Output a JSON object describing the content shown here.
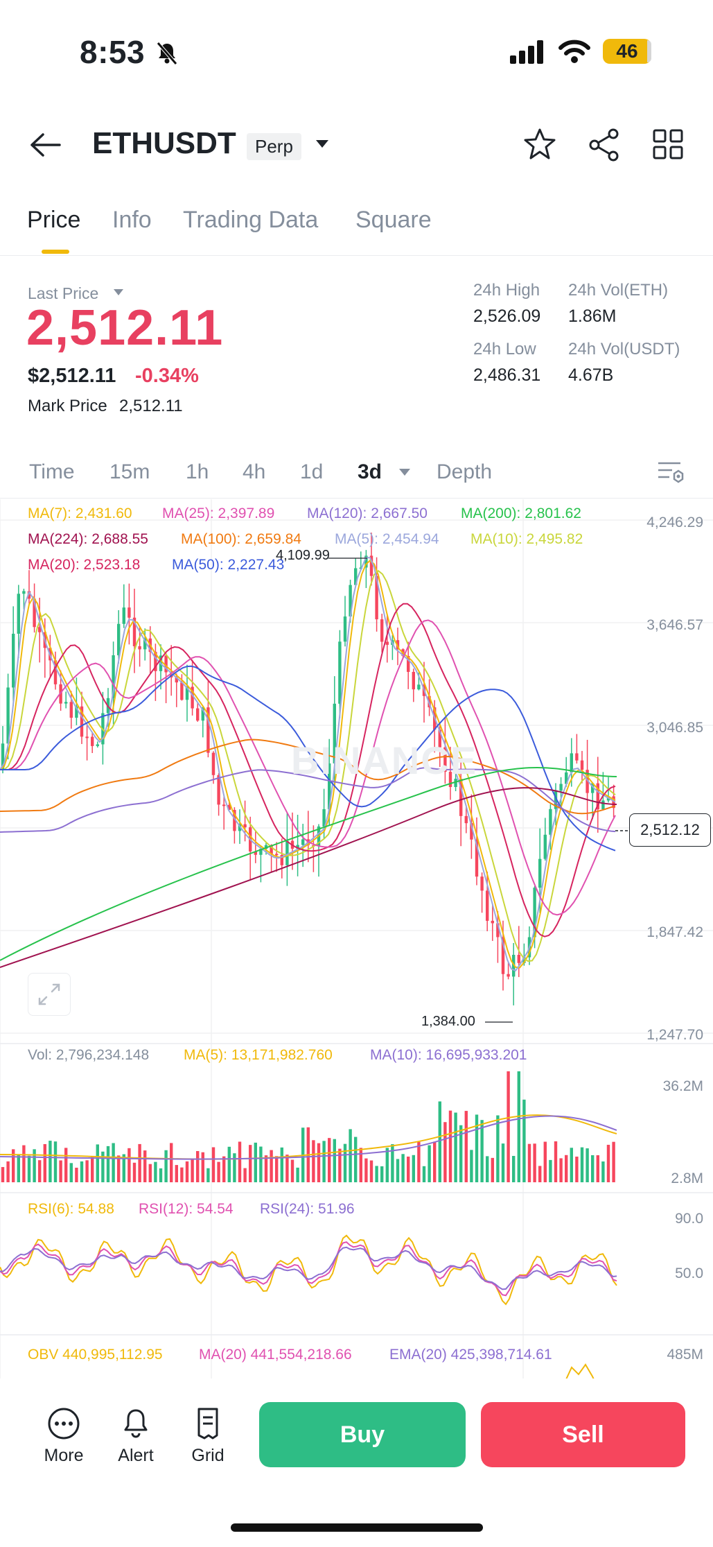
{
  "status_bar": {
    "time": "8:53",
    "battery": "46"
  },
  "header": {
    "symbol": "ETHUSDT",
    "contract_type": "Perp"
  },
  "tabs": [
    {
      "label": "Price",
      "active": true
    },
    {
      "label": "Info",
      "active": false
    },
    {
      "label": "Trading Data",
      "active": false
    },
    {
      "label": "Square",
      "active": false
    }
  ],
  "ticker": {
    "last_price_label": "Last Price",
    "last_price": "2,512.11",
    "usd_price": "$2,512.11",
    "change_pct": "-0.34%",
    "mark_price_label": "Mark Price",
    "mark_price": "2,512.11",
    "high_label": "24h High",
    "high": "2,526.09",
    "low_label": "24h Low",
    "low": "2,486.31",
    "vol_eth_label": "24h Vol(ETH)",
    "vol_eth": "1.86M",
    "vol_usdt_label": "24h Vol(USDT)",
    "vol_usdt": "4.67B"
  },
  "intervals": [
    {
      "label": "Time",
      "active": false
    },
    {
      "label": "15m",
      "active": false
    },
    {
      "label": "1h",
      "active": false
    },
    {
      "label": "4h",
      "active": false
    },
    {
      "label": "1d",
      "active": false
    },
    {
      "label": "3d",
      "active": true
    },
    {
      "label": "Depth",
      "active": false
    }
  ],
  "ma_legend": [
    {
      "label": "MA(7): 2,431.60",
      "color": "#f0b90b"
    },
    {
      "label": "MA(25): 2,397.89",
      "color": "#e051b0"
    },
    {
      "label": "MA(120): 2,667.50",
      "color": "#8c6fd1"
    },
    {
      "label": "MA(200): 2,801.62",
      "color": "#27c24c"
    },
    {
      "label": "MA(224): 2,688.55",
      "color": "#a0124f"
    },
    {
      "label": "MA(100): 2,659.84",
      "color": "#f07a11"
    },
    {
      "label": "MA(5): 2,454.94",
      "color": "#9ba7dc"
    },
    {
      "label": "MA(10): 2,495.82",
      "color": "#c9d63b"
    },
    {
      "label": "MA(20): 2,523.18",
      "color": "#d6245f"
    },
    {
      "label": "MA(50): 2,227.43",
      "color": "#3b5bdb"
    }
  ],
  "price_axis": [
    "4,246.29",
    "3,646.57",
    "3,046.85",
    "1,847.42",
    "1,247.70"
  ],
  "chart_annotations": {
    "high_marker": "4,109.99",
    "low_marker": "1,384.00",
    "current_price_tag": "2,512.12",
    "watermark": "BINANCE"
  },
  "volume": {
    "vol_label": "Vol: 2,796,234.148",
    "ma5_label": "MA(5): 13,171,982.760",
    "ma10_label": "MA(10): 16,695,933.201",
    "axis_top": "36.2M",
    "axis_bottom": "2.8M"
  },
  "rsi": {
    "rsi6_label": "RSI(6): 54.88",
    "rsi12_label": "RSI(12): 54.54",
    "rsi24_label": "RSI(24): 51.96",
    "axis_top": "90.0",
    "axis_mid": "50.0"
  },
  "obv": {
    "obv_label": "OBV 440,995,112.95",
    "ma20_label": "MA(20) 441,554,218.66",
    "ema20_label": "EMA(20) 425,398,714.61",
    "axis": "485M"
  },
  "bottom_bar": {
    "more": "More",
    "alert": "Alert",
    "grid": "Grid",
    "buy": "Buy",
    "sell": "Sell"
  },
  "colors": {
    "up": "#2ebd85",
    "down": "#f6465d",
    "accent": "#f0b90b"
  }
}
